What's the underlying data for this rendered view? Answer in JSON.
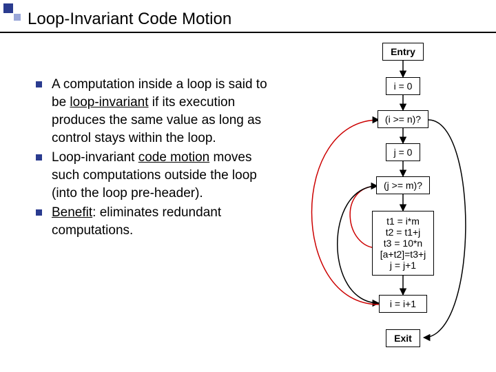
{
  "title": "Loop-Invariant Code Motion",
  "bullets": [
    {
      "pre": "A computation inside a loop is said to be ",
      "u": "loop-invariant",
      "post": " if its execution produces the same value as long as control stays within the loop."
    },
    {
      "pre": "Loop-invariant ",
      "u": "code motion",
      "post": " moves such computations outside the loop (into the loop pre-header)."
    },
    {
      "pre": "",
      "u": "Benefit",
      "post": ": eliminates redundant computations."
    }
  ],
  "nodes": {
    "entry": "Entry",
    "a": "i = 0",
    "b": "(i >= n)?",
    "c": "j = 0",
    "d": "(j >= m)?",
    "e1": "t1 = i*m",
    "e2": "t2 = t1+j",
    "e3": "t3 = 10*n",
    "e4": "[a+t2]=t3+j",
    "e5": "j = j+1",
    "f": "i = i+1",
    "exit": "Exit"
  }
}
